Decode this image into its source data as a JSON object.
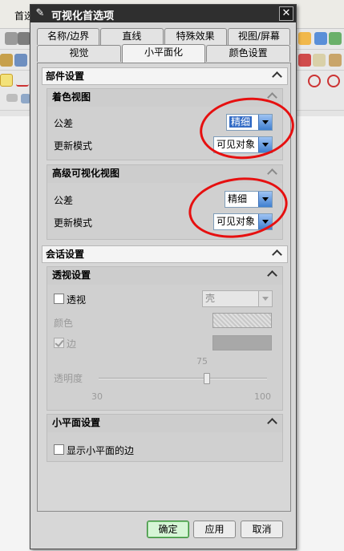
{
  "bg_app": {
    "menu_text": "首选"
  },
  "dialog": {
    "title": "可视化首选项",
    "close_label": "✕",
    "tabs_row1": [
      "名称/边界",
      "直线",
      "特殊效果",
      "视图/屏幕"
    ],
    "tabs_row2": [
      "视觉",
      "小平面化",
      "颜色设置"
    ],
    "active_tab": "小平面化"
  },
  "part_settings": {
    "header": "部件设置",
    "shaded_view": {
      "header": "着色视图",
      "tolerance_label": "公差",
      "tolerance_value": "精细",
      "update_mode_label": "更新模式",
      "update_mode_value": "可见对象"
    },
    "advanced_view": {
      "header": "高级可视化视图",
      "tolerance_label": "公差",
      "tolerance_value": "精细",
      "update_mode_label": "更新模式",
      "update_mode_value": "可见对象"
    }
  },
  "session_settings": {
    "header": "会话设置",
    "perspective": {
      "header": "透视设置",
      "perspective_label": "透视",
      "perspective_checked": false,
      "shell_select_value": "壳",
      "color_label": "颜色",
      "edge_label": "边",
      "edge_checked": true,
      "transparency_label": "透明度",
      "slider_value": "75",
      "slider_value_number": 75,
      "slider_min": "30",
      "slider_max": "100"
    },
    "facet": {
      "header": "小平面设置",
      "show_edges_label": "显示小平面的边",
      "show_edges_checked": false
    }
  },
  "buttons": {
    "ok": "确定",
    "apply": "应用",
    "cancel": "取消"
  },
  "colors": {
    "titlebar": "#2f2f2f",
    "select_arrow": "#3f7fd0",
    "primary_button": "#d6f5d6",
    "annotation": "#e61010"
  }
}
